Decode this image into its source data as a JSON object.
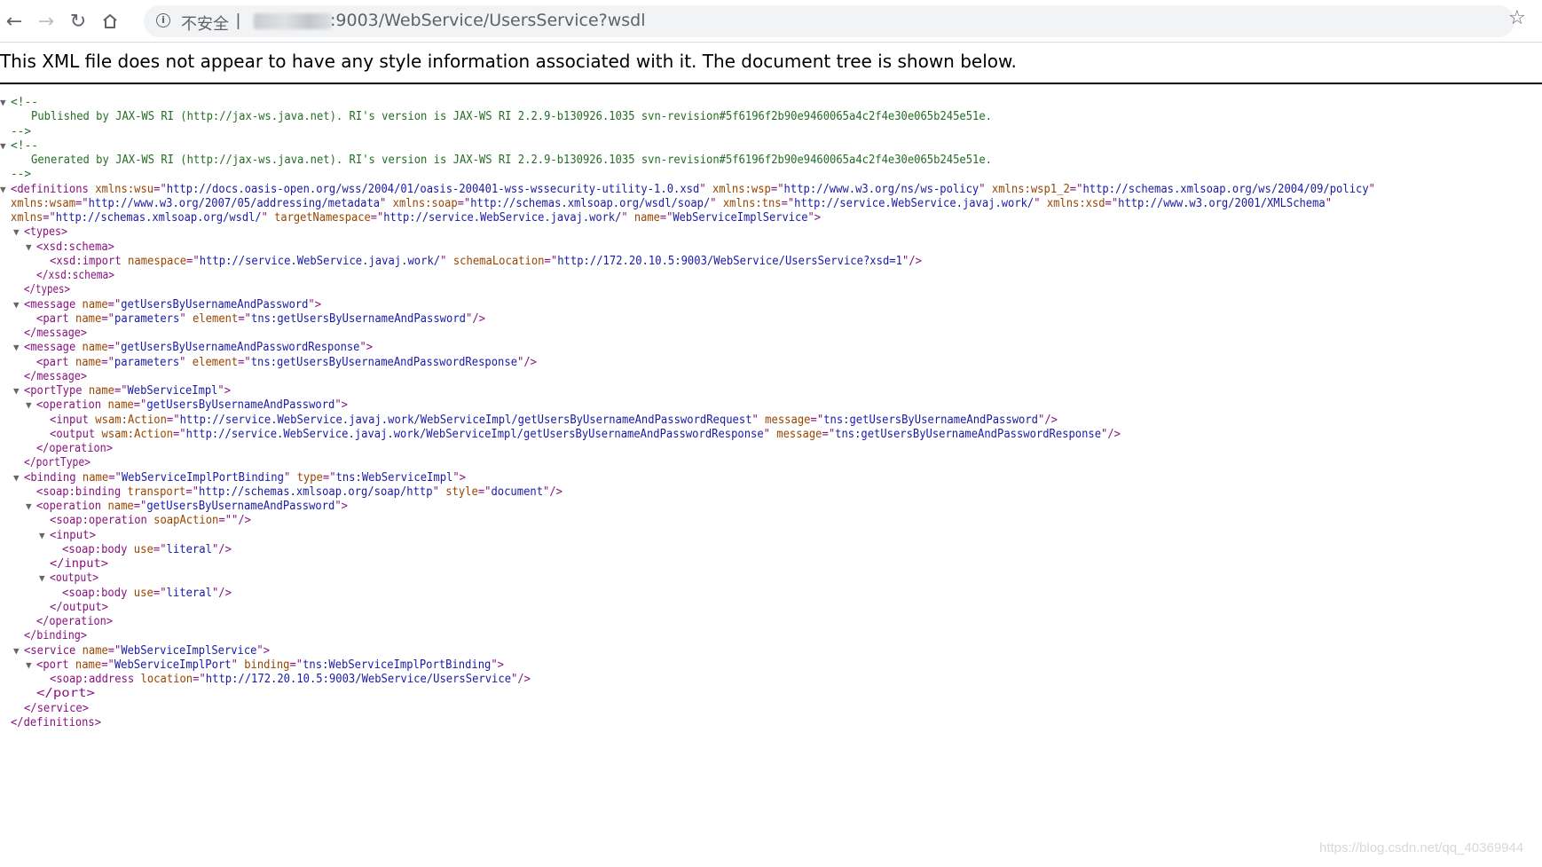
{
  "toolbar": {
    "insecure_label": "不安全",
    "separator": "|",
    "url_rest": ":9003/WebService/UsersService?wsdl"
  },
  "banner": "This XML file does not appear to have any style information associated with it. The document tree is shown below.",
  "xml_lines": [
    {
      "toggle": true,
      "parts": [
        [
          "cm",
          "<!--"
        ]
      ]
    },
    {
      "parts": [
        [
          "cm",
          "Published by JAX-WS RI (http://jax-ws.java.net). RI's version is JAX-WS RI 2.2.9-b130926.1035 svn-revision#5f6196f2b90e9460065a4c2f4e30e065b245e51e."
        ]
      ]
    },
    {
      "parts": [
        [
          "cm",
          "-->"
        ]
      ]
    },
    {
      "toggle": true,
      "parts": [
        [
          "cm",
          "<!--"
        ]
      ]
    },
    {
      "parts": [
        [
          "cm",
          "Generated by JAX-WS RI (http://jax-ws.java.net). RI's version is JAX-WS RI 2.2.9-b130926.1035 svn-revision#5f6196f2b90e9460065a4c2f4e30e065b245e51e."
        ]
      ]
    },
    {
      "parts": [
        [
          "cm",
          "-->"
        ]
      ]
    },
    {
      "toggle": true,
      "parts": [
        [
          "tg",
          "<definitions"
        ],
        [
          "an",
          " xmlns:wsu"
        ],
        [
          "tg",
          "=\""
        ],
        [
          "av",
          "http://docs.oasis-open.org/wss/2004/01/oasis-200401-wss-wssecurity-utility-1.0.xsd"
        ],
        [
          "tg",
          "\""
        ],
        [
          "an",
          " xmlns:wsp"
        ],
        [
          "tg",
          "=\""
        ],
        [
          "av",
          "http://www.w3.org/ns/ws-policy"
        ],
        [
          "tg",
          "\""
        ],
        [
          "an",
          " xmlns:wsp1_2"
        ],
        [
          "tg",
          "=\""
        ],
        [
          "av",
          "http://schemas.xmlsoap.org/ws/2004/09/policy"
        ],
        [
          "tg",
          "\""
        ]
      ]
    },
    {
      "parts": [
        [
          "an",
          "xmlns:wsam"
        ],
        [
          "tg",
          "=\""
        ],
        [
          "av",
          "http://www.w3.org/2007/05/addressing/metadata"
        ],
        [
          "tg",
          "\""
        ],
        [
          "an",
          " xmlns:soap"
        ],
        [
          "tg",
          "=\""
        ],
        [
          "av",
          "http://schemas.xmlsoap.org/wsdl/soap/"
        ],
        [
          "tg",
          "\""
        ],
        [
          "an",
          " xmlns:tns"
        ],
        [
          "tg",
          "=\""
        ],
        [
          "av",
          "http://service.WebService.javaj.work/"
        ],
        [
          "tg",
          "\""
        ],
        [
          "an",
          " xmlns:xsd"
        ],
        [
          "tg",
          "=\""
        ],
        [
          "av",
          "http://www.w3.org/2001/XMLSchema"
        ],
        [
          "tg",
          "\""
        ]
      ]
    },
    {
      "parts": [
        [
          "an",
          "xmlns"
        ],
        [
          "tg",
          "=\""
        ],
        [
          "av",
          "http://schemas.xmlsoap.org/wsdl/"
        ],
        [
          "tg",
          "\""
        ],
        [
          "an",
          " targetNamespace"
        ],
        [
          "tg",
          "=\""
        ],
        [
          "av",
          "http://service.WebService.javaj.work/"
        ],
        [
          "tg",
          "\""
        ],
        [
          "an",
          " name"
        ],
        [
          "tg",
          "=\""
        ],
        [
          "av",
          "WebServiceImplService"
        ],
        [
          "tg",
          "\">"
        ]
      ]
    },
    {
      "toggle": true,
      "parts": [
        [
          "tg",
          "<types>"
        ]
      ]
    },
    {
      "toggle": true,
      "parts": [
        [
          "tg",
          "<xsd:schema>"
        ]
      ]
    },
    {
      "parts": [
        [
          "tg",
          "<xsd:import"
        ],
        [
          "an",
          " namespace"
        ],
        [
          "tg",
          "=\""
        ],
        [
          "av",
          "http://service.WebService.javaj.work/"
        ],
        [
          "tg",
          "\""
        ],
        [
          "an",
          " schemaLocation"
        ],
        [
          "tg",
          "=\""
        ],
        [
          "av",
          "http://172.20.10.5:9003/WebService/UsersService?xsd=1"
        ],
        [
          "tg",
          "\"/>"
        ]
      ]
    },
    {
      "parts": [
        [
          "tg",
          "</xsd:schema>"
        ]
      ]
    },
    {
      "parts": [
        [
          "tg",
          "</types>"
        ]
      ]
    },
    {
      "toggle": true,
      "parts": [
        [
          "tg",
          "<message"
        ],
        [
          "an",
          " name"
        ],
        [
          "tg",
          "=\""
        ],
        [
          "av",
          "getUsersByUsernameAndPassword"
        ],
        [
          "tg",
          "\">"
        ]
      ]
    },
    {
      "parts": [
        [
          "tg",
          "<part"
        ],
        [
          "an",
          " name"
        ],
        [
          "tg",
          "=\""
        ],
        [
          "av",
          "parameters"
        ],
        [
          "tg",
          "\""
        ],
        [
          "an",
          " element"
        ],
        [
          "tg",
          "=\""
        ],
        [
          "av",
          "tns:getUsersByUsernameAndPassword"
        ],
        [
          "tg",
          "\"/>"
        ]
      ]
    },
    {
      "parts": [
        [
          "tg",
          "</message>"
        ]
      ]
    },
    {
      "toggle": true,
      "parts": [
        [
          "tg",
          "<message"
        ],
        [
          "an",
          " name"
        ],
        [
          "tg",
          "=\""
        ],
        [
          "av",
          "getUsersByUsernameAndPasswordResponse"
        ],
        [
          "tg",
          "\">"
        ]
      ]
    },
    {
      "parts": [
        [
          "tg",
          "<part"
        ],
        [
          "an",
          " name"
        ],
        [
          "tg",
          "=\""
        ],
        [
          "av",
          "parameters"
        ],
        [
          "tg",
          "\""
        ],
        [
          "an",
          " element"
        ],
        [
          "tg",
          "=\""
        ],
        [
          "av",
          "tns:getUsersByUsernameAndPasswordResponse"
        ],
        [
          "tg",
          "\"/>"
        ]
      ]
    },
    {
      "parts": [
        [
          "tg",
          "</message>"
        ]
      ]
    },
    {
      "toggle": true,
      "parts": [
        [
          "tg",
          "<portType"
        ],
        [
          "an",
          " name"
        ],
        [
          "tg",
          "=\""
        ],
        [
          "av",
          "WebServiceImpl"
        ],
        [
          "tg",
          "\">"
        ]
      ]
    },
    {
      "toggle": true,
      "parts": [
        [
          "tg",
          "<operation"
        ],
        [
          "an",
          " name"
        ],
        [
          "tg",
          "=\""
        ],
        [
          "av",
          "getUsersByUsernameAndPassword"
        ],
        [
          "tg",
          "\">"
        ]
      ]
    },
    {
      "parts": [
        [
          "tg",
          "<input"
        ],
        [
          "an",
          " wsam:Action"
        ],
        [
          "tg",
          "=\""
        ],
        [
          "av",
          "http://service.WebService.javaj.work/WebServiceImpl/getUsersByUsernameAndPasswordRequest"
        ],
        [
          "tg",
          "\""
        ],
        [
          "an",
          " message"
        ],
        [
          "tg",
          "=\""
        ],
        [
          "av",
          "tns:getUsersByUsernameAndPassword"
        ],
        [
          "tg",
          "\"/>"
        ]
      ]
    },
    {
      "parts": [
        [
          "tg",
          "<output"
        ],
        [
          "an",
          " wsam:Action"
        ],
        [
          "tg",
          "=\""
        ],
        [
          "av",
          "http://service.WebService.javaj.work/WebServiceImpl/getUsersByUsernameAndPasswordResponse"
        ],
        [
          "tg",
          "\""
        ],
        [
          "an",
          " message"
        ],
        [
          "tg",
          "=\""
        ],
        [
          "av",
          "tns:getUsersByUsernameAndPasswordResponse"
        ],
        [
          "tg",
          "\"/>"
        ]
      ]
    },
    {
      "parts": [
        [
          "tg",
          "</operation>"
        ]
      ]
    },
    {
      "parts": [
        [
          "tg",
          "</portType>"
        ]
      ]
    },
    {
      "toggle": true,
      "parts": [
        [
          "tg",
          "<binding"
        ],
        [
          "an",
          " name"
        ],
        [
          "tg",
          "=\""
        ],
        [
          "av",
          "WebServiceImplPortBinding"
        ],
        [
          "tg",
          "\""
        ],
        [
          "an",
          " type"
        ],
        [
          "tg",
          "=\""
        ],
        [
          "av",
          "tns:WebServiceImpl"
        ],
        [
          "tg",
          "\">"
        ]
      ]
    },
    {
      "parts": [
        [
          "tg",
          "<soap:binding"
        ],
        [
          "an",
          " transport"
        ],
        [
          "tg",
          "=\""
        ],
        [
          "av",
          "http://schemas.xmlsoap.org/soap/http"
        ],
        [
          "tg",
          "\""
        ],
        [
          "an",
          " style"
        ],
        [
          "tg",
          "=\""
        ],
        [
          "av",
          "document"
        ],
        [
          "tg",
          "\"/>"
        ]
      ]
    },
    {
      "toggle": true,
      "parts": [
        [
          "tg",
          "<operation"
        ],
        [
          "an",
          " name"
        ],
        [
          "tg",
          "=\""
        ],
        [
          "av",
          "getUsersByUsernameAndPassword"
        ],
        [
          "tg",
          "\">"
        ]
      ]
    },
    {
      "parts": [
        [
          "tg",
          "<soap:operation"
        ],
        [
          "an",
          " soapAction"
        ],
        [
          "tg",
          "=\"\"/>"
        ]
      ]
    },
    {
      "toggle": true,
      "parts": [
        [
          "tg",
          "<input>"
        ]
      ]
    },
    {
      "parts": [
        [
          "tg",
          "<soap:body"
        ],
        [
          "an",
          " use"
        ],
        [
          "tg",
          "=\""
        ],
        [
          "av",
          "literal"
        ],
        [
          "tg",
          "\"/>"
        ]
      ]
    },
    {
      "parts": [
        [
          "tg",
          "</input>"
        ]
      ]
    },
    {
      "toggle": true,
      "parts": [
        [
          "tg",
          "<output>"
        ]
      ]
    },
    {
      "parts": [
        [
          "tg",
          "<soap:body"
        ],
        [
          "an",
          " use"
        ],
        [
          "tg",
          "=\""
        ],
        [
          "av",
          "literal"
        ],
        [
          "tg",
          "\"/>"
        ]
      ]
    },
    {
      "parts": [
        [
          "tg",
          "</output>"
        ]
      ]
    },
    {
      "parts": [
        [
          "tg",
          "</operation>"
        ]
      ]
    },
    {
      "parts": [
        [
          "tg",
          "</binding>"
        ]
      ]
    },
    {
      "toggle": true,
      "parts": [
        [
          "tg",
          "<service"
        ],
        [
          "an",
          " name"
        ],
        [
          "tg",
          "=\""
        ],
        [
          "av",
          "WebServiceImplService"
        ],
        [
          "tg",
          "\">"
        ]
      ]
    },
    {
      "toggle": true,
      "parts": [
        [
          "tg",
          "<port"
        ],
        [
          "an",
          " name"
        ],
        [
          "tg",
          "=\""
        ],
        [
          "av",
          "WebServiceImplPort"
        ],
        [
          "tg",
          "\""
        ],
        [
          "an",
          " binding"
        ],
        [
          "tg",
          "=\""
        ],
        [
          "av",
          "tns:WebServiceImplPortBinding"
        ],
        [
          "tg",
          "\">"
        ]
      ]
    },
    {
      "parts": [
        [
          "tg",
          "<soap:address"
        ],
        [
          "an",
          " location"
        ],
        [
          "tg",
          "=\""
        ],
        [
          "av",
          "http://172.20.10.5:9003/WebService/UsersService"
        ],
        [
          "tg",
          "\"/>"
        ]
      ]
    },
    {
      "parts": [
        [
          "tg",
          "</port>"
        ]
      ]
    },
    {
      "parts": [
        [
          "tg",
          "</service>"
        ]
      ]
    },
    {
      "parts": [
        [
          "tg",
          "</definitions>"
        ]
      ]
    }
  ],
  "watermark": "https://blog.csdn.net/qq_40369944"
}
